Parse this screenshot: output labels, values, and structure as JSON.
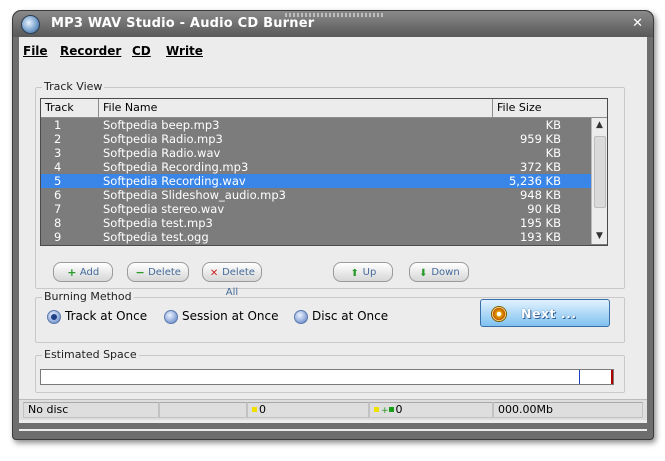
{
  "window": {
    "title": "MP3 WAV Studio - Audio CD Burner",
    "close_glyph": "✕"
  },
  "menu": [
    "File",
    "Recorder",
    "CD",
    "Write"
  ],
  "track_view": {
    "label": "Track View",
    "columns": [
      "Track",
      "File Name",
      "File Size"
    ],
    "rows": [
      {
        "track": "1",
        "name": "Softpedia beep.mp3",
        "size": "KB",
        "selected": false
      },
      {
        "track": "2",
        "name": "Softpedia Radio.mp3",
        "size": "959 KB",
        "selected": false
      },
      {
        "track": "3",
        "name": "Softpedia Radio.wav",
        "size": "KB",
        "selected": false
      },
      {
        "track": "4",
        "name": "Softpedia Recording.mp3",
        "size": "372 KB",
        "selected": false
      },
      {
        "track": "5",
        "name": "Softpedia Recording.wav",
        "size": "5,236 KB",
        "selected": true
      },
      {
        "track": "6",
        "name": "Softpedia Slideshow_audio.mp3",
        "size": "948 KB",
        "selected": false
      },
      {
        "track": "7",
        "name": "Softpedia stereo.wav",
        "size": "90 KB",
        "selected": false
      },
      {
        "track": "8",
        "name": "Softpedia test.mp3",
        "size": "195 KB",
        "selected": false
      },
      {
        "track": "9",
        "name": "Softpedia test.ogg",
        "size": "193 KB",
        "selected": false
      }
    ]
  },
  "buttons": {
    "add": "Add",
    "delete": "Delete",
    "delete_all": "Delete All",
    "up": "Up",
    "down": "Down"
  },
  "burning": {
    "label": "Burning Method",
    "options": [
      "Track at Once",
      "Session at Once",
      "Disc at Once"
    ],
    "selected_index": 0,
    "next": "Next ..."
  },
  "estimated_space": {
    "label": "Estimated  Space",
    "fill_fraction": 0.94
  },
  "status": {
    "disc": "No disc",
    "count_yellow": "0",
    "count_green": "0",
    "size": "000.00Mb"
  },
  "colors": {
    "selection": "#3a86e8",
    "list_bg": "#7c7c7c",
    "next_button": "#7fc1f0"
  }
}
